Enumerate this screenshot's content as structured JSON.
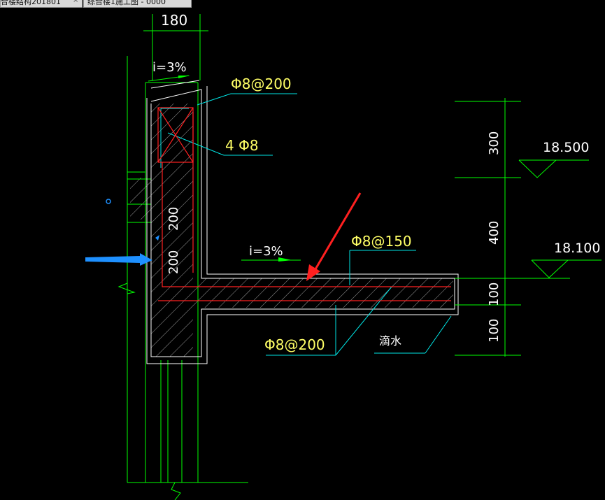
{
  "tabs": [
    {
      "label": "合楼结构201801",
      "close": "×",
      "active": true
    },
    {
      "label": "综合楼1施工图 - 0000",
      "close": "",
      "active": false
    }
  ],
  "dimensions": {
    "top_width": "180",
    "parapet_height": "300",
    "wall_height": "400",
    "slab_thickness": "100",
    "below_slab": "100",
    "parapet_inner_upper": "200",
    "parapet_inner_lower": "200"
  },
  "rebar": {
    "top_stirrup": "Φ8@200",
    "corner_bars": "4 Φ8",
    "slab_top": "Φ8@150",
    "slab_bottom": "Φ8@200"
  },
  "slopes": {
    "top": "i=3%",
    "slab": "i=3%"
  },
  "elevations": {
    "upper": "18.500",
    "lower": "18.100"
  },
  "notes": {
    "drip": "滴水"
  },
  "colors": {
    "background": "#000000",
    "outline": "#ffffff",
    "wall": "#00ff00",
    "dim": "#00ff00",
    "leader": "#00e5e5",
    "text": "#ffff66",
    "rebar": "#ff2020",
    "annotation_arrow": "#ff2020",
    "pointer_arrow": "#1e90ff"
  }
}
